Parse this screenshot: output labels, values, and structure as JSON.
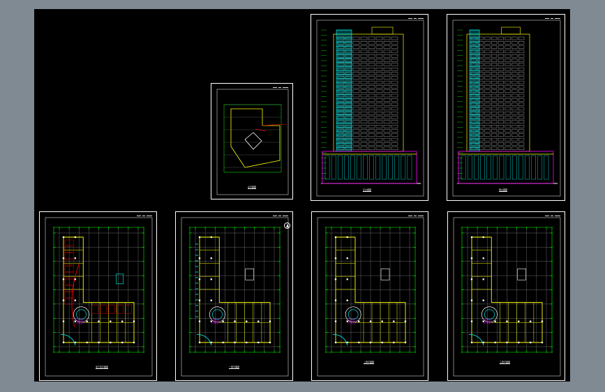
{
  "viewport": {
    "background": "#000000",
    "frame_color": "#7f8a93"
  },
  "sheets": [
    {
      "id": "site-plan",
      "kind": "site",
      "caption": "总平面图",
      "scale": "1:500"
    },
    {
      "id": "front-elevation",
      "kind": "elevation",
      "caption": "正立面图",
      "scale": "1:100"
    },
    {
      "id": "side-elevation",
      "kind": "elevation",
      "caption": "侧立面图",
      "scale": "1:100"
    },
    {
      "id": "basement-plan",
      "kind": "plan",
      "caption": "地下室平面图",
      "scale": "1:100"
    },
    {
      "id": "first-floor-plan",
      "kind": "plan",
      "caption": "一层平面图",
      "scale": "1:100"
    },
    {
      "id": "second-floor-plan",
      "kind": "plan",
      "caption": "二层平面图",
      "scale": "1:100"
    },
    {
      "id": "third-floor-plan",
      "kind": "plan",
      "caption": "三层平面图",
      "scale": "1:100"
    }
  ],
  "colors": {
    "frame": "#ffffff",
    "wall": "#ffff00",
    "axis": "#00ff00",
    "grid": "#808080",
    "glass": "#00ffff",
    "stair": "#ff00ff",
    "accent": "#ff0000"
  }
}
